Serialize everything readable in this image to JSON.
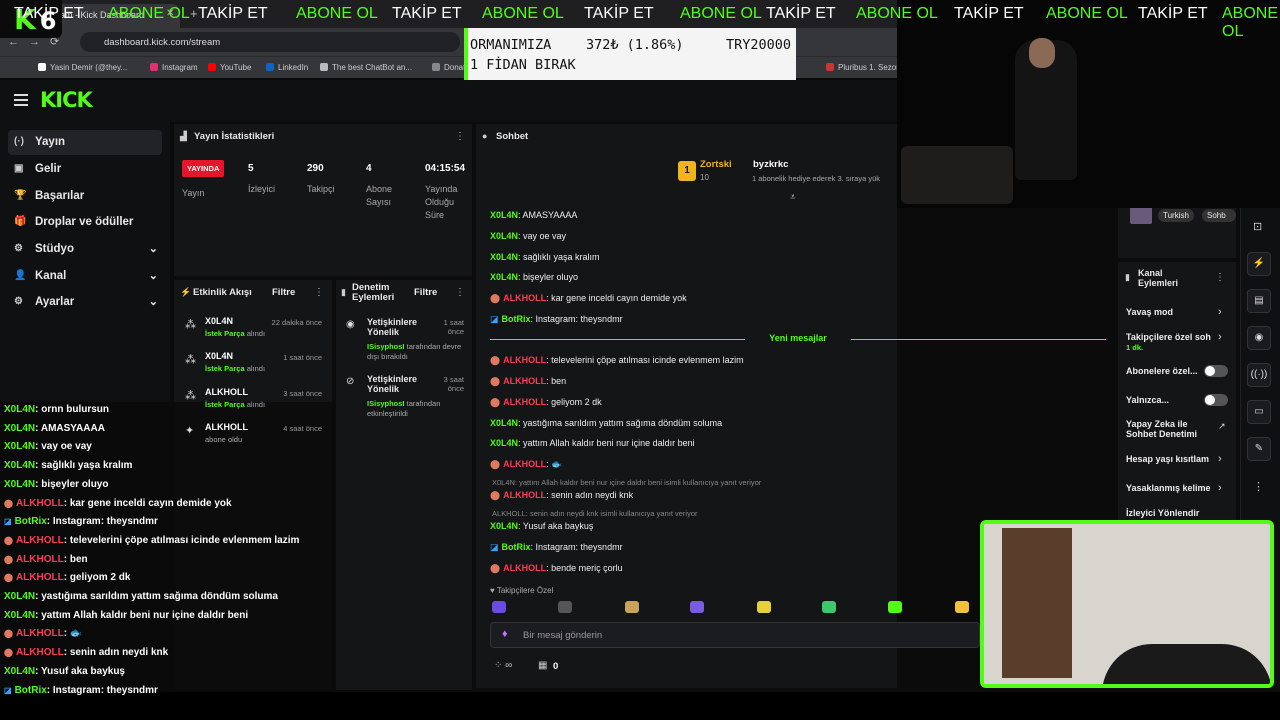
{
  "browser": {
    "tab_title": "am - Kick Dashboard",
    "tab_close": "✕",
    "new_tab": "+",
    "nav_icons": "←→⟳",
    "url": "dashboard.kick.com/stream",
    "bookmarks": [
      {
        "label": "Yasin Demir (@they...",
        "color": "#ffffff"
      },
      {
        "label": "Instagram",
        "color": "#e1306c"
      },
      {
        "label": "YouTube",
        "color": "#ff0000"
      },
      {
        "label": "LinkedIn",
        "color": "#0a66c2"
      },
      {
        "label": "The best ChatBot an...",
        "color": "#bbbbbb"
      },
      {
        "label": "Donate B",
        "color": "#888888"
      },
      {
        "label": "Pluribus 1. Sezon 1",
        "color": "#cc3333"
      }
    ]
  },
  "overlay_logo": {
    "k": "K",
    "num": "6"
  },
  "ticker": {
    "line1_left": "ORMANIMIZA",
    "line1_mid": "372₺ (1.86%)",
    "line1_right": "TRY20000",
    "line2": "1 FİDAN BIRAK"
  },
  "header": {
    "logo": "KICK"
  },
  "sidebar": {
    "items": [
      {
        "label": "Yayın",
        "icon": "(·)",
        "active": true
      },
      {
        "label": "Gelir",
        "icon": "▣"
      },
      {
        "label": "Başarılar",
        "icon": "🏆"
      },
      {
        "label": "Droplar ve ödüller",
        "icon": "🎁"
      },
      {
        "label": "Stüdyo",
        "icon": "⚙",
        "chevron": "⌄"
      },
      {
        "label": "Kanal",
        "icon": "👤",
        "chevron": "⌄"
      },
      {
        "label": "Ayarlar",
        "icon": "⚙",
        "chevron": "⌄"
      }
    ]
  },
  "stats": {
    "title": "Yayın İstatistikleri",
    "live_badge": "YAYINDA",
    "live_label": "Yayın",
    "viewers": {
      "value": "5",
      "label": "İzleyici"
    },
    "followers": {
      "value": "290",
      "label": "Takipçi"
    },
    "subs": {
      "value": "4",
      "label": "Abone Sayısı"
    },
    "uptime": {
      "value": "04:15:54",
      "label": "Yayında Olduğu Süre"
    }
  },
  "activity": {
    "title": "Etkinlik Akışı",
    "filter": "Filtre",
    "items": [
      {
        "user": "X0L4N",
        "time": "22 dakika önce",
        "item": "İstek Parça",
        "suffix": "alındı"
      },
      {
        "user": "X0L4N",
        "time": "1 saat önce",
        "item": "İstek Parça",
        "suffix": "alındı"
      },
      {
        "user": "ALKHOLL",
        "time": "3 saat önce",
        "item": "İstek Parça",
        "suffix": "alındı"
      },
      {
        "user": "ALKHOLL",
        "time": "4 saat önce",
        "item": "",
        "suffix": "abone oldu"
      }
    ]
  },
  "modlog": {
    "title": "Denetim Eylemleri",
    "filter": "Filtre",
    "items": [
      {
        "title": "Yetişkinlere Yönelik",
        "time": "1 saat önce",
        "actor": "ISisyphosI",
        "text": "tarafından devre dışı bırakıldı"
      },
      {
        "title": "Yetişkinlere Yönelik",
        "time": "3 saat önce",
        "actor": "ISisyphosI",
        "text": "tarafından etkinleştirildi"
      }
    ]
  },
  "chat": {
    "title": "Sohbet",
    "pinned_user1": "Zortski",
    "pinned_count": "10",
    "pinned_user2": "byzkrkc",
    "pinned_text": "1 abonelik hediye ederek 3. sıraya yük",
    "new_messages": "Yeni mesajlar",
    "messages": [
      {
        "user": "X0L4N",
        "text": "AMASYAAAA",
        "color": "g"
      },
      {
        "user": "X0L4N",
        "text": "vay oe vay",
        "color": "g"
      },
      {
        "user": "X0L4N",
        "text": "sağlıklı yaşa kralım",
        "color": "g"
      },
      {
        "user": "X0L4N",
        "text": "bişeyler oluyo",
        "color": "g"
      },
      {
        "user": "ALKHOLL",
        "text": "kar gene inceldi cayın demide yok",
        "color": "r"
      },
      {
        "user": "BotRix",
        "text": "Instagram: theysndmr",
        "color": "g"
      },
      {
        "user": "ALKHOLL",
        "text": "televelerini çöpe atılması icinde evlenmem lazim",
        "color": "r"
      },
      {
        "user": "ALKHOLL",
        "text": "ben",
        "color": "r"
      },
      {
        "user": "ALKHOLL",
        "text": "geliyom 2 dk",
        "color": "r"
      },
      {
        "user": "X0L4N",
        "text": "yastığıma sarıldım yattım sağıma döndüm soluma",
        "color": "g"
      },
      {
        "user": "X0L4N",
        "text": "yattım Allah kaldır beni nur içine daldır beni",
        "color": "g"
      },
      {
        "user": "ALKHOLL",
        "text": "🐟",
        "color": "r"
      },
      {
        "user": "ALKHOLL",
        "text": "senin adın neydi knk",
        "color": "r"
      },
      {
        "user": "X0L4N",
        "text": "Yusuf aka baykuş",
        "color": "g"
      },
      {
        "user": "BotRix",
        "text": "Instagram: theysndmr",
        "color": "g"
      },
      {
        "user": "ALKHOLL",
        "text": "bende meriç çorlu",
        "color": "r"
      }
    ],
    "reply1": "X0L4N: yattım Allah kaldır beni nur içine daldır beni isimli kullanıcıya yanıt veriyor",
    "reply2": "ALKHOLL: senin adın neydi knk isimli kullanıcıya yanıt veriyor",
    "followers_only": "Takipçilere Özel",
    "input_placeholder": "Bir mesaj gönderin",
    "footer_count": "0"
  },
  "modpanel": {
    "tags": [
      "Turkish",
      "Sohb"
    ],
    "title": "Kanal Eylemleri",
    "items": [
      {
        "label": "Yavaş mod"
      },
      {
        "label": "Takipçilere özel soh",
        "sub": "1 dk."
      },
      {
        "label": "Abonelere özel..."
      },
      {
        "label": "Yalnızca..."
      },
      {
        "label": "Yapay Zeka ile Sohbet Denetimi"
      },
      {
        "label": "Hesap yaşı kısıtlam"
      },
      {
        "label": "Yasaklanmış kelime"
      },
      {
        "label": "İzleyici Yönlendir"
      }
    ]
  },
  "overlay_chat": [
    {
      "user": "X0L4N",
      "text": ": ornn bulursun",
      "color": "g"
    },
    {
      "user": "X0L4N",
      "text": ": AMASYAAAA",
      "color": "g"
    },
    {
      "user": "X0L4N",
      "text": ": vay oe vay",
      "color": "g"
    },
    {
      "user": "X0L4N",
      "text": ": sağlıklı yaşa kralım",
      "color": "g"
    },
    {
      "user": "X0L4N",
      "text": ": bişeyler oluyo",
      "color": "g"
    },
    {
      "user": "ALKHOLL",
      "text": ": kar gene inceldi cayın demide yok",
      "color": "r"
    },
    {
      "user": "BotRix",
      "text": ": Instagram: theysndmr",
      "color": "g"
    },
    {
      "user": "ALKHOLL",
      "text": ": televelerini çöpe atılması icinde evlenmem lazim",
      "color": "r"
    },
    {
      "user": "ALKHOLL",
      "text": ": ben",
      "color": "r"
    },
    {
      "user": "ALKHOLL",
      "text": ": geliyom 2 dk",
      "color": "r"
    },
    {
      "user": "X0L4N",
      "text": ": yastığıma sarıldım yattım sağıma döndüm soluma",
      "color": "g"
    },
    {
      "user": "X0L4N",
      "text": ": yattım Allah kaldır beni nur içine daldır beni",
      "color": "g"
    },
    {
      "user": "ALKHOLL",
      "text": ": 🐟",
      "color": "r"
    },
    {
      "user": "ALKHOLL",
      "text": ": senin adın neydi knk",
      "color": "r"
    },
    {
      "user": "X0L4N",
      "text": ": Yusuf aka baykuş",
      "color": "g"
    },
    {
      "user": "BotRix",
      "text": ": Instagram: theysndmr",
      "color": "g"
    }
  ],
  "marquee": {
    "follow": "TAKİP ET",
    "subscribe": "ABONE OL"
  },
  "colors": {
    "kick_green": "#53fc18",
    "live_red": "#e4162c",
    "user_red": "#ff3b55"
  }
}
